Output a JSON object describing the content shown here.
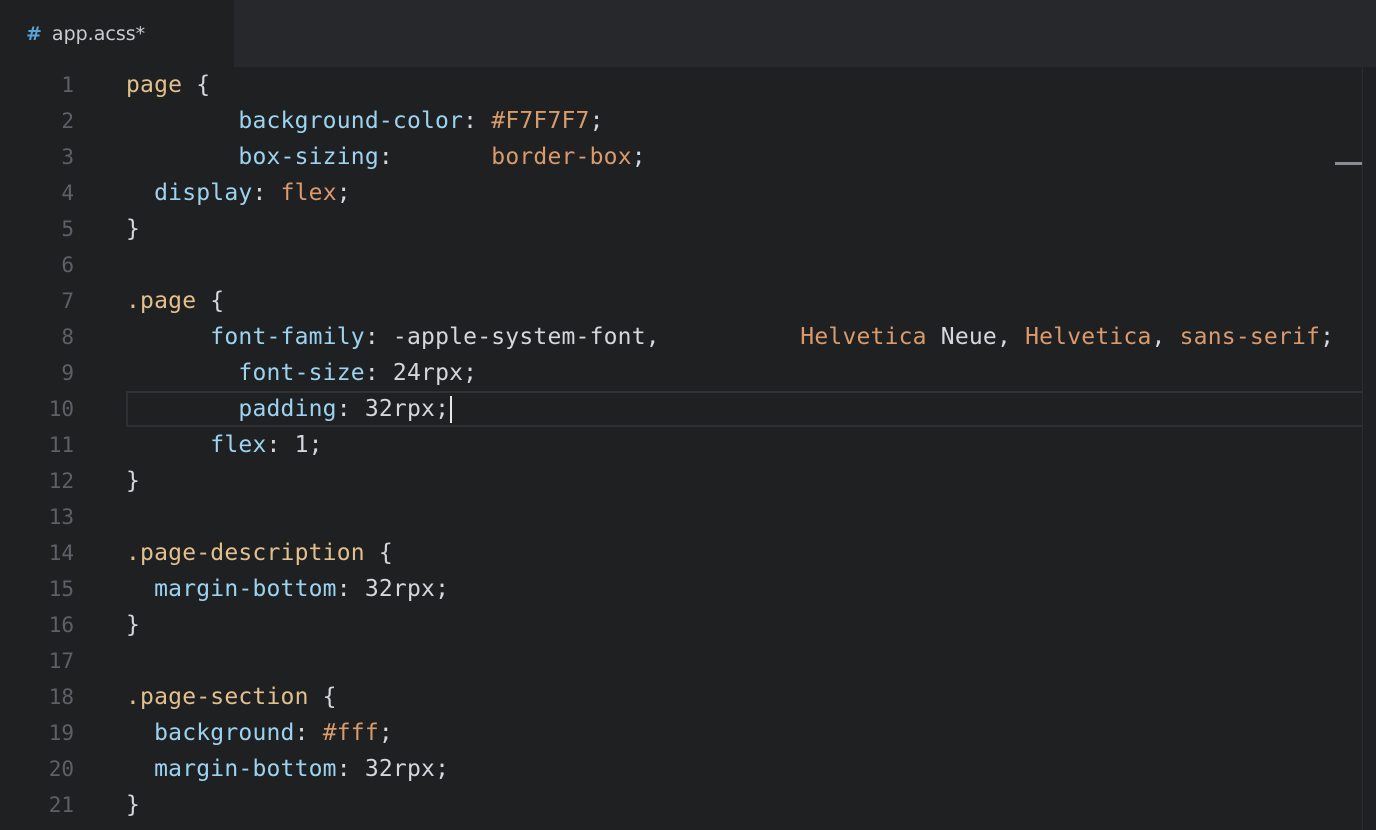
{
  "tab": {
    "icon": "#",
    "title": "app.acss*"
  },
  "lines": [
    {
      "n": "1",
      "tokens": [
        [
          "sel",
          "page"
        ],
        [
          "punc",
          " {"
        ]
      ]
    },
    {
      "n": "2",
      "tokens": [
        [
          "punc",
          "        "
        ],
        [
          "prop",
          "background-color"
        ],
        [
          "punc",
          ": "
        ],
        [
          "val",
          "#F7F7F7"
        ],
        [
          "punc",
          ";"
        ]
      ]
    },
    {
      "n": "3",
      "tokens": [
        [
          "punc",
          "        "
        ],
        [
          "prop",
          "box-sizing"
        ],
        [
          "punc",
          ":       "
        ],
        [
          "val",
          "border-box"
        ],
        [
          "punc",
          ";"
        ]
      ]
    },
    {
      "n": "4",
      "tokens": [
        [
          "punc",
          "  "
        ],
        [
          "prop",
          "display"
        ],
        [
          "punc",
          ": "
        ],
        [
          "val",
          "flex"
        ],
        [
          "punc",
          ";"
        ]
      ]
    },
    {
      "n": "5",
      "tokens": [
        [
          "punc",
          "}"
        ]
      ]
    },
    {
      "n": "6",
      "tokens": []
    },
    {
      "n": "7",
      "tokens": [
        [
          "sel",
          ".page"
        ],
        [
          "punc",
          " {"
        ]
      ]
    },
    {
      "n": "8",
      "tokens": [
        [
          "punc",
          "      "
        ],
        [
          "prop",
          "font-family"
        ],
        [
          "punc",
          ": -apple-system-font,          "
        ],
        [
          "val",
          "Helvetica"
        ],
        [
          "punc",
          " Neue, "
        ],
        [
          "val",
          "Helvetica"
        ],
        [
          "punc",
          ", "
        ],
        [
          "val",
          "sans-serif"
        ],
        [
          "punc",
          ";"
        ]
      ]
    },
    {
      "n": "9",
      "tokens": [
        [
          "punc",
          "        "
        ],
        [
          "prop",
          "font-size"
        ],
        [
          "punc",
          ": 24rpx;"
        ]
      ]
    },
    {
      "n": "10",
      "tokens": [
        [
          "punc",
          "        "
        ],
        [
          "prop",
          "padding"
        ],
        [
          "punc",
          ": 32rpx;"
        ]
      ],
      "cursor": true
    },
    {
      "n": "11",
      "tokens": [
        [
          "punc",
          "      "
        ],
        [
          "prop",
          "flex"
        ],
        [
          "punc",
          ": 1;"
        ]
      ]
    },
    {
      "n": "12",
      "tokens": [
        [
          "punc",
          "}"
        ]
      ]
    },
    {
      "n": "13",
      "tokens": []
    },
    {
      "n": "14",
      "tokens": [
        [
          "sel",
          ".page-description"
        ],
        [
          "punc",
          " {"
        ]
      ]
    },
    {
      "n": "15",
      "tokens": [
        [
          "punc",
          "  "
        ],
        [
          "prop",
          "margin-bottom"
        ],
        [
          "punc",
          ": 32rpx;"
        ]
      ]
    },
    {
      "n": "16",
      "tokens": [
        [
          "punc",
          "}"
        ]
      ]
    },
    {
      "n": "17",
      "tokens": []
    },
    {
      "n": "18",
      "tokens": [
        [
          "sel",
          ".page-section"
        ],
        [
          "punc",
          " {"
        ]
      ]
    },
    {
      "n": "19",
      "tokens": [
        [
          "punc",
          "  "
        ],
        [
          "prop",
          "background"
        ],
        [
          "punc",
          ": "
        ],
        [
          "val",
          "#fff"
        ],
        [
          "punc",
          ";"
        ]
      ]
    },
    {
      "n": "20",
      "tokens": [
        [
          "punc",
          "  "
        ],
        [
          "prop",
          "margin-bottom"
        ],
        [
          "punc",
          ": 32rpx;"
        ]
      ]
    },
    {
      "n": "21",
      "tokens": [
        [
          "punc",
          "}"
        ]
      ]
    }
  ]
}
